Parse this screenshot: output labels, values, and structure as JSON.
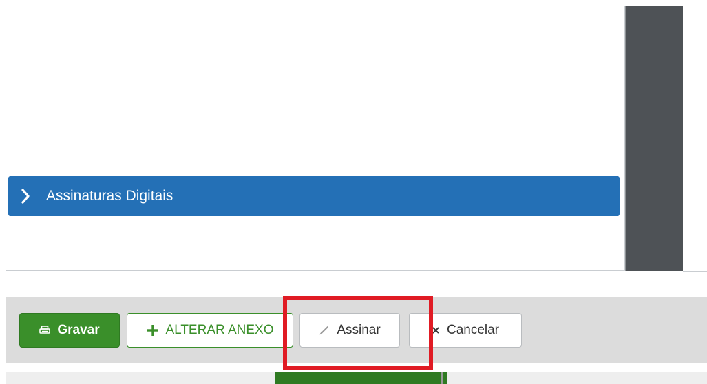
{
  "panel": {
    "accordion_label": "Assinaturas Digitais"
  },
  "toolbar": {
    "gravar_label": "Gravar",
    "alterar_anexo_label": "ALTERAR ANEXO",
    "assinar_label": "Assinar",
    "cancelar_label": "Cancelar"
  },
  "icons": {
    "accordion": "chevron-right-icon",
    "gravar": "printer-icon",
    "alterar_anexo": "plus-icon",
    "assinar": "pencil-icon",
    "cancelar": "close-icon"
  },
  "colors": {
    "accordion_blue": "#2470b6",
    "primary_green": "#3a8f2a",
    "highlight_red": "#e01b24",
    "sidebar_dark": "#4e5256",
    "toolbar_bg": "#dcdcdc"
  }
}
